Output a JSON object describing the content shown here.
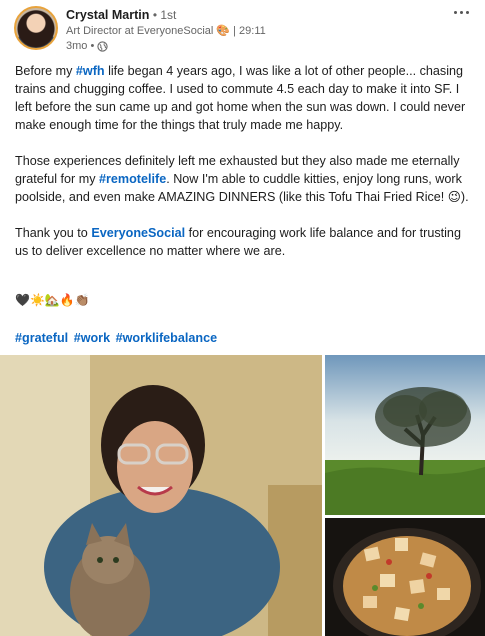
{
  "post": {
    "author": {
      "name": "Crystal Martin",
      "degree": "• 1st",
      "title": "Art Director at EveryoneSocial 🎨 | 29:11",
      "time": "3mo •",
      "avatar_icon": "profile-photo"
    },
    "body": {
      "p1": {
        "a": "Before my ",
        "tag": "#wfh",
        "b": " life began 4 years ago, I was like a lot of other people... chasing trains and chugging coffee. I used to commute 4.5 each day to make it into SF. I left before the sun came up and got home when the sun was down. I could never make enough time for the things that truly made me happy."
      },
      "p2": {
        "a": "Those experiences definitely left me exhausted but they also made me eternally grateful for my ",
        "tag": "#remotelife",
        "b": ". Now I'm able to cuddle kitties, enjoy long runs, work poolside, and even make AMAZING DINNERS (like this Tofu Thai Fried Rice! 😉)."
      },
      "p3": {
        "a": "Thank you to ",
        "mention": "EveryoneSocial",
        "b": " for encouraging work life balance and for trusting us to deliver excellence no matter where we are."
      },
      "emojis": "🖤☀️🏡🔥👏🏽",
      "hashtags": [
        "#grateful",
        "#work",
        "#worklifebalance"
      ]
    },
    "images": {
      "main": "selfie-with-cat",
      "top_right": "oak-tree-landscape",
      "bottom_right": "tofu-thai-fried-rice"
    }
  },
  "colors": {
    "link": "#0a66c2",
    "text": "#1d1d1d",
    "muted": "#666666",
    "avatar_ring": "#e8a33c"
  }
}
